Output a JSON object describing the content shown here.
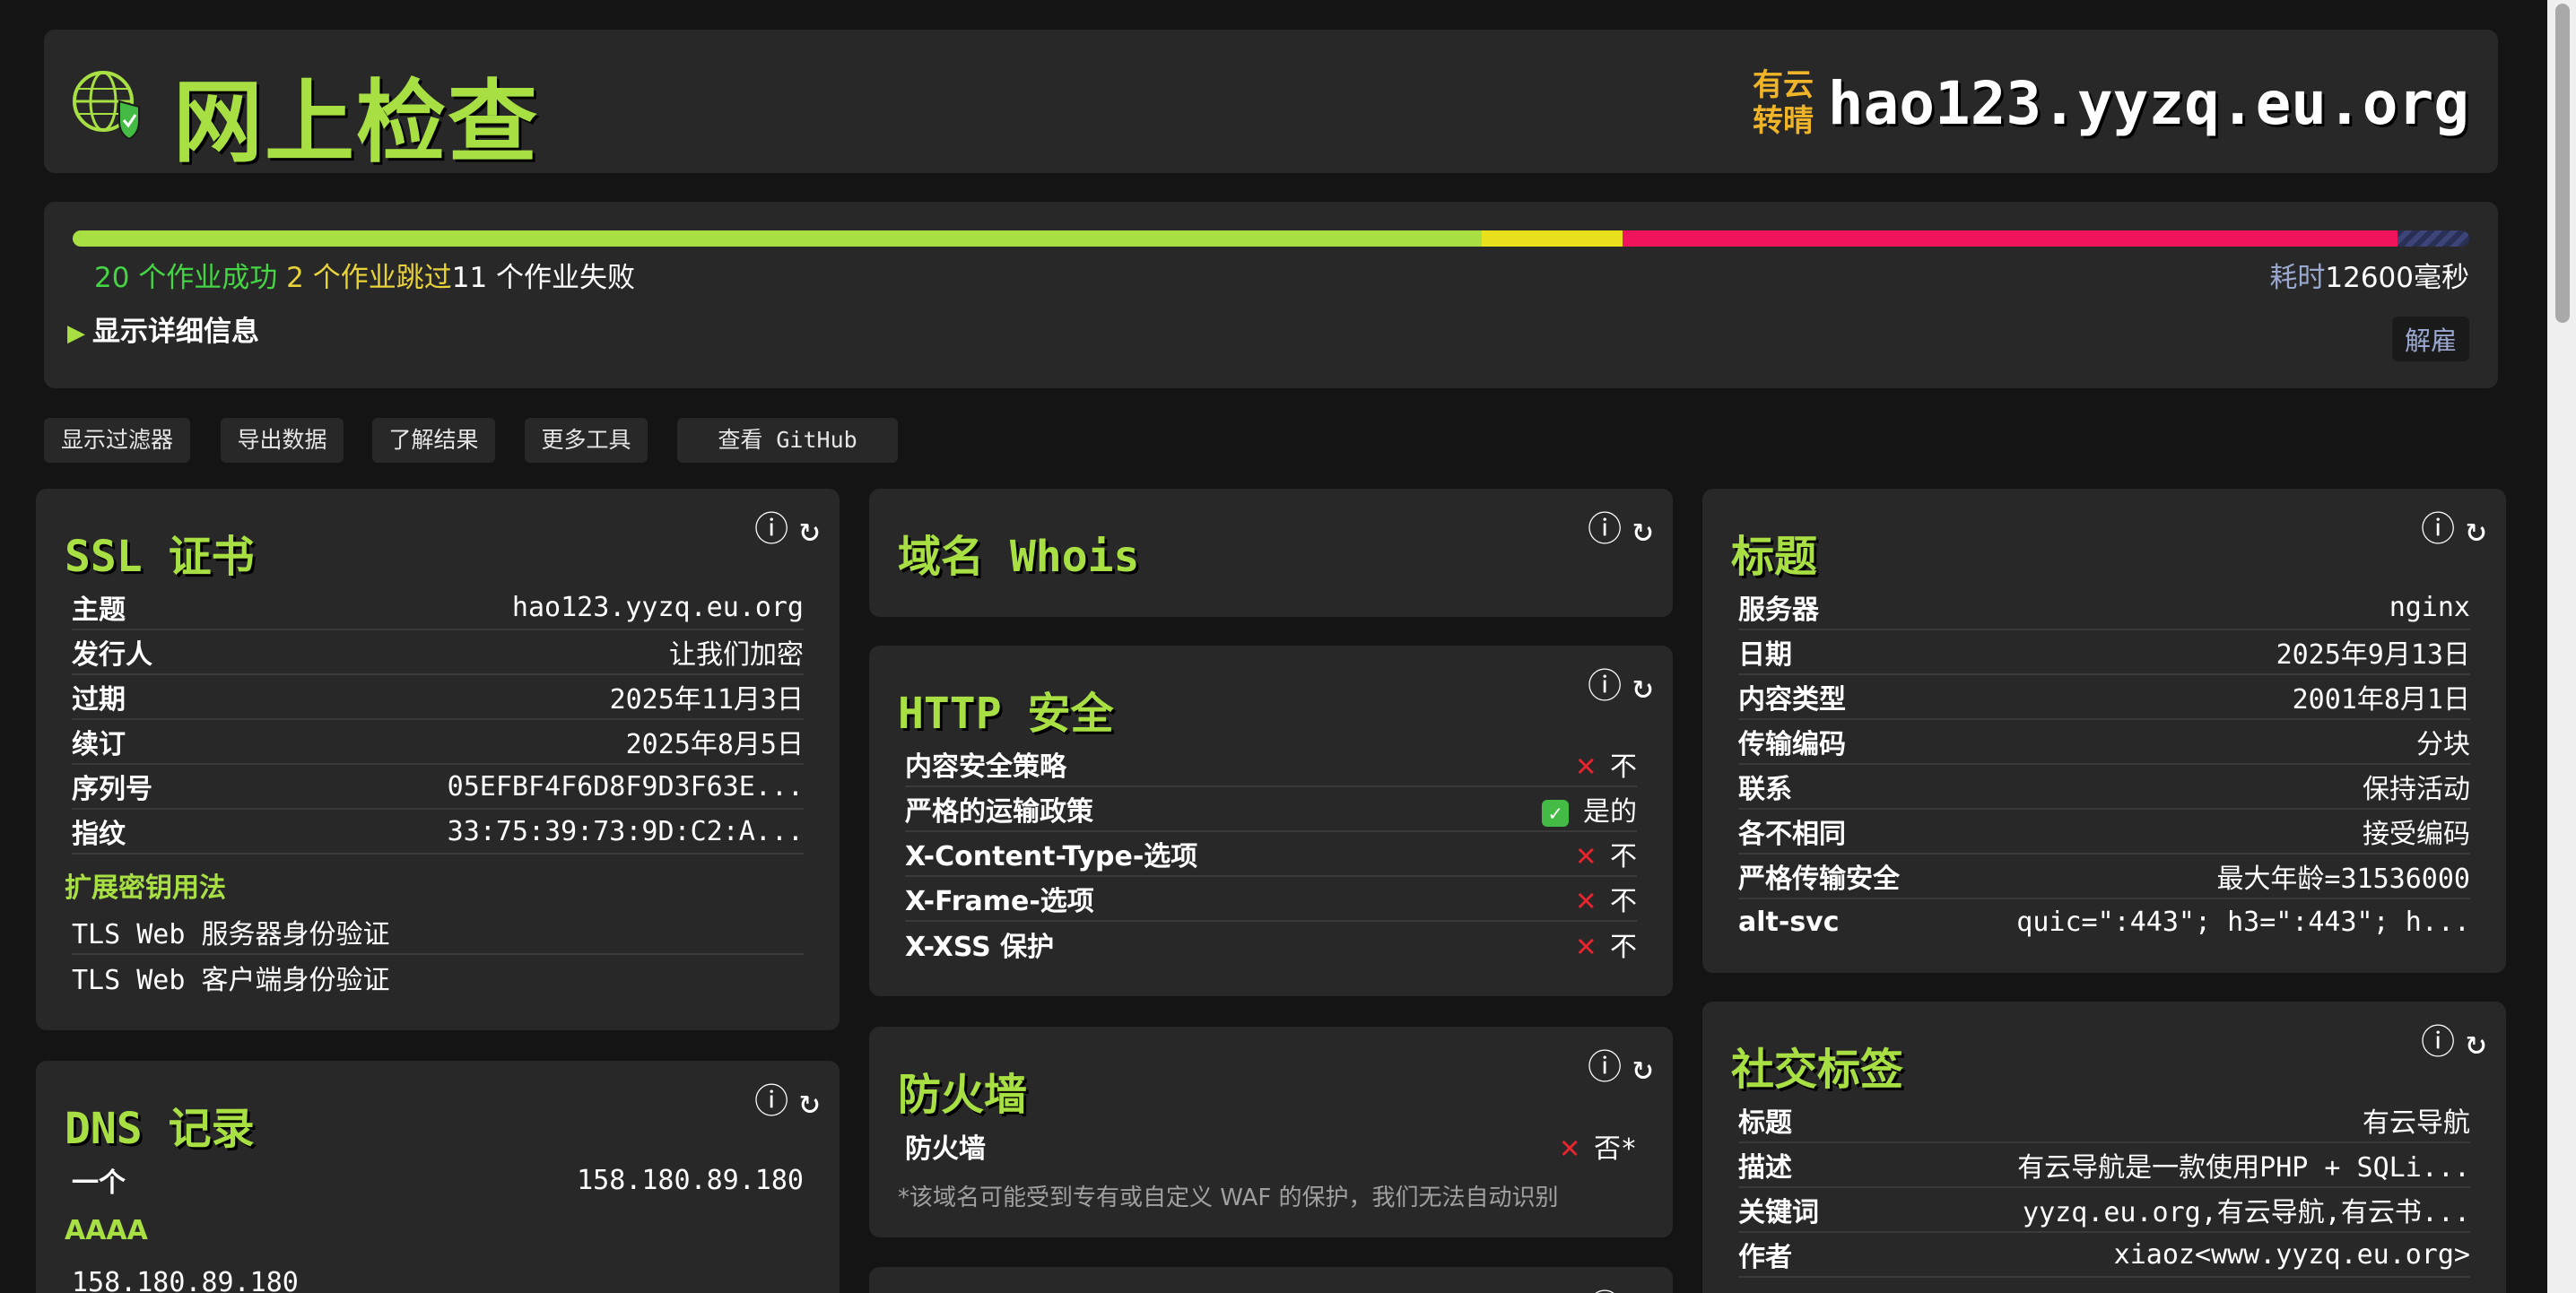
{
  "header": {
    "title": "网上检查",
    "weather": "有云转晴",
    "domain": "hao123.yyzq.eu.org"
  },
  "progress": {
    "success": 20,
    "skipped": 2,
    "failed": 11,
    "success_text": "20 个作业成功",
    "skipped_text": "2 个作业跳过",
    "failed_text": "11 个作业失败",
    "elapsed_label": "耗时",
    "elapsed_value": "12600毫秒",
    "details_label": "显示详细信息",
    "dismiss_label": "解雇",
    "colors": {
      "success": "#a8e043",
      "skipped": "#e8e01c",
      "failed": "#f0155a",
      "pending": "#2a2f55"
    }
  },
  "toolbar": {
    "filter": "显示过滤器",
    "export": "导出数据",
    "results": "了解结果",
    "tools": "更多工具",
    "github": "查看 GitHub"
  },
  "icons": {
    "info": "info-icon",
    "refresh": "refresh-icon",
    "globe": "globe-shield-icon"
  },
  "ssl": {
    "title": "SSL 证书",
    "rows": [
      {
        "k": "主题",
        "v": "hao123.yyzq.eu.org"
      },
      {
        "k": "发行人",
        "v": "让我们加密"
      },
      {
        "k": "过期",
        "v": "2025年11月3日"
      },
      {
        "k": "续订",
        "v": "2025年8月5日"
      },
      {
        "k": "序列号",
        "v": "05EFBF4F6D8F9D3F63E..."
      },
      {
        "k": "指纹",
        "v": "33:75:39:73:9D:C2:A..."
      }
    ],
    "eku_title": "扩展密钥用法",
    "eku": [
      "TLS Web 服务器身份验证",
      "TLS Web 客户端身份验证"
    ]
  },
  "dns": {
    "title": "DNS 记录",
    "a_label": "一个",
    "a_value": "158.180.89.180",
    "aaaa_label": "AAAA",
    "aaaa_value": "158.180.89.180"
  },
  "whois": {
    "title": "域名 Whois"
  },
  "http_security": {
    "title": "HTTP 安全",
    "rows": [
      {
        "k": "内容安全策略",
        "v": "不",
        "ok": false
      },
      {
        "k": "严格的运输政策",
        "v": "是的",
        "ok": true
      },
      {
        "k": "X-Content-Type-选项",
        "v": "不",
        "ok": false
      },
      {
        "k": "X-Frame-选项",
        "v": "不",
        "ok": false
      },
      {
        "k": "X-XSS 保护",
        "v": "不",
        "ok": false
      }
    ]
  },
  "firewall": {
    "title": "防火墙",
    "label": "防火墙",
    "value": "否*",
    "note": "*该域名可能受到专有或自定义 WAF 的保护，我们无法自动识别"
  },
  "headers": {
    "title": "标题",
    "rows": [
      {
        "k": "服务器",
        "v": "nginx"
      },
      {
        "k": "日期",
        "v": "2025年9月13日"
      },
      {
        "k": "内容类型",
        "v": "2001年8月1日"
      },
      {
        "k": "传输编码",
        "v": "分块"
      },
      {
        "k": "联系",
        "v": "保持活动"
      },
      {
        "k": "各不相同",
        "v": "接受编码"
      },
      {
        "k": "严格传输安全",
        "v": "最大年龄=31536000"
      },
      {
        "k": "alt-svc",
        "v": "quic=\":443\"; h3=\":443\"; h..."
      }
    ]
  },
  "social": {
    "title": "社交标签",
    "rows": [
      {
        "k": "标题",
        "v": "有云导航"
      },
      {
        "k": "描述",
        "v": "有云导航是一款使用PHP + SQLi..."
      },
      {
        "k": "关键词",
        "v": "yyzq.eu.org,有云导航,有云书..."
      },
      {
        "k": "作者",
        "v": "xiaoz<www.yyzq.eu.org>"
      }
    ]
  }
}
